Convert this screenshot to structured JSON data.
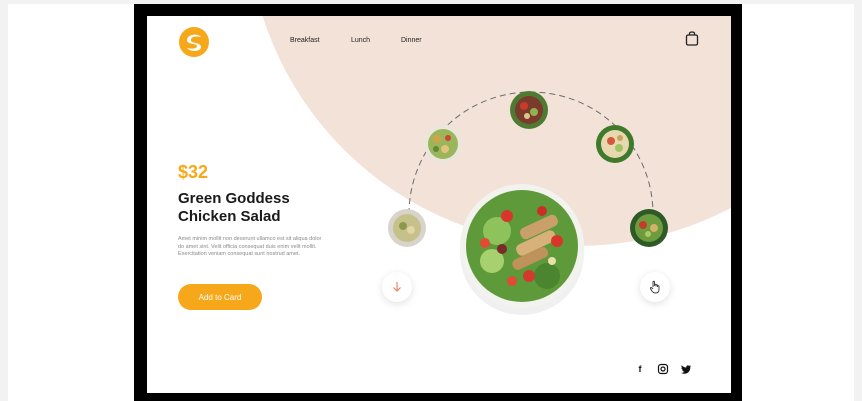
{
  "colors": {
    "accent": "#f6a81a",
    "blob": "#f3e2d7",
    "frame": "#000000"
  },
  "nav": {
    "items": [
      {
        "label": "Breakfast"
      },
      {
        "label": "Lunch"
      },
      {
        "label": "Dinner"
      }
    ]
  },
  "icons": {
    "logo": "logo-icon",
    "cart": "shopping-bag-icon",
    "scroll_down": "arrow-down-icon",
    "pointer": "hand-pointer-icon",
    "facebook": "facebook-icon",
    "instagram": "instagram-icon",
    "twitter": "twitter-icon"
  },
  "product": {
    "price": "$32",
    "title_line1": "Green Goddess",
    "title_line2": "Chicken Salad",
    "description": "Amet minim mollit non deserunt ullamco est sit aliqua dolor do amet sint. Velit officia consequat duis enim velit mollit. Exercitation veniam consequat sunt nostrud amet.",
    "add_button": "Add to Card"
  },
  "social": {
    "facebook": "f",
    "instagram": "◎",
    "twitter": "🐦"
  }
}
